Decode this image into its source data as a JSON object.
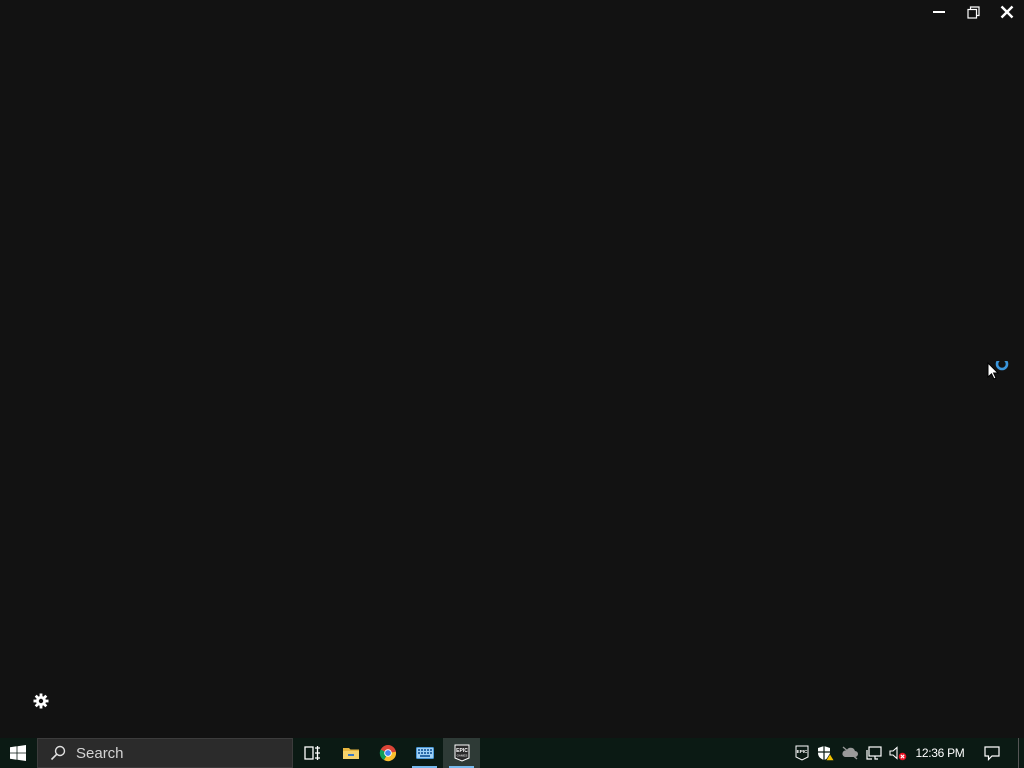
{
  "window": {
    "controls": {
      "minimize": "minimize",
      "restore": "restore",
      "close": "close"
    },
    "loading": true
  },
  "taskbar": {
    "search": {
      "placeholder": "Search"
    },
    "pinned": [
      {
        "name": "task-view",
        "icon": "task-view-icon"
      },
      {
        "name": "file-explorer",
        "icon": "folder-icon"
      },
      {
        "name": "chrome",
        "icon": "chrome-icon"
      },
      {
        "name": "on-screen-keyboard",
        "icon": "keyboard-icon",
        "active": true
      },
      {
        "name": "epic-games-launcher",
        "icon": "epic-games-icon",
        "active": true,
        "focused": true
      }
    ],
    "tray": {
      "epic_label": "EPIC",
      "icons": [
        "epic-games-tray-icon",
        "windows-security-warning-icon",
        "onedrive-offline-icon",
        "network-icon",
        "volume-muted-icon"
      ]
    },
    "clock": {
      "time": "12:36 PM"
    }
  },
  "colors": {
    "background": "#121212",
    "taskbar": "#0b1a14",
    "accent": "#76b9ed",
    "spinner": "#3a96dd"
  }
}
